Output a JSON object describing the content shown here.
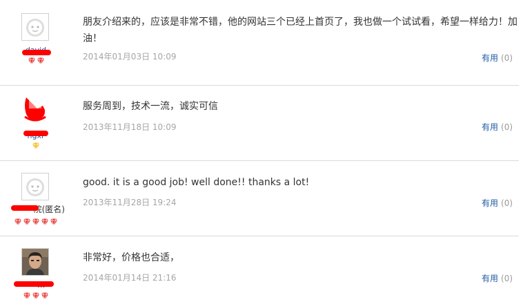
{
  "reviews": [
    {
      "username": "david",
      "content": "朋友介绍来的，应该是非常不错，他的网站三个已经上首页了，我也做一个试试看，希望一样给力！加油！",
      "date": "2014年01月03日 10:09",
      "useful_label": "有用",
      "useful_count": "(0)",
      "level_icon": "red-diamond-icon",
      "level_count": 2,
      "avatar": "default-face-icon"
    },
    {
      "username": "hgxr",
      "content": "服务周到，技术一流，诚实可信",
      "date": "2013年11月18日 10:09",
      "useful_label": "有用",
      "useful_count": "(0)",
      "level_icon": "yellow-diamond-icon",
      "level_count": 1,
      "avatar": "photo-avatar-icon"
    },
    {
      "username": "院(匿名)",
      "content": "good. it is a good job! well done!! thanks a lot!",
      "date": "2013年11月28日 19:24",
      "useful_label": "有用",
      "useful_count": "(0)",
      "level_icon": "red-diamond-icon",
      "level_count": 5,
      "avatar": "default-face-icon"
    },
    {
      "username": "...",
      "content": "非常好，价格也合适，",
      "date": "2014年01月14日 21:16",
      "useful_label": "有用",
      "useful_count": "(0)",
      "level_icon": "red-diamond-icon",
      "level_count": 3,
      "avatar": "photo-avatar-icon"
    }
  ],
  "colors": {
    "link": "#1f5ba6",
    "muted": "#a6a6a6",
    "redaction": "#ff0000",
    "diamond_red": "#e8312f",
    "diamond_yellow": "#f2b90c"
  }
}
